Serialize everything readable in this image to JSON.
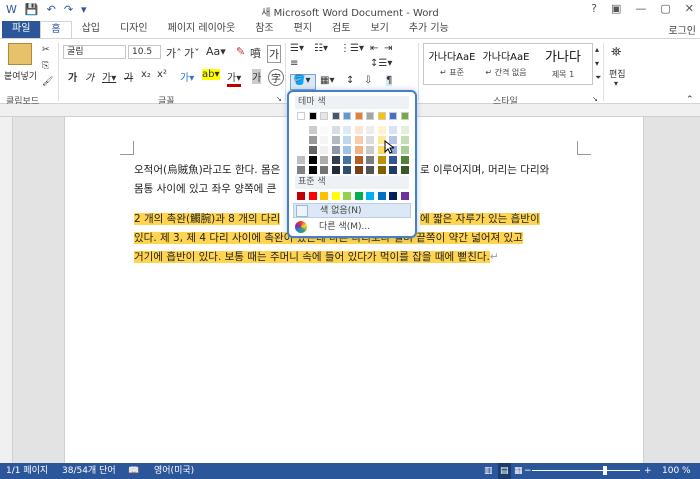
{
  "window": {
    "title": "새 Microsoft Word Document - Word"
  },
  "qat": {
    "save": "save",
    "undo": "undo",
    "redo": "redo"
  },
  "window_controls": {
    "help": "?",
    "ribbon_opts": "▣",
    "minimize": "—",
    "maximize": "▢",
    "close": "✕"
  },
  "tabs": [
    "파일",
    "홈",
    "삽입",
    "디자인",
    "페이지 레이아웃",
    "참조",
    "편지",
    "검토",
    "보기",
    "추가 기능"
  ],
  "account": "로그인",
  "ribbon": {
    "clipboard": {
      "paste_label": "붙여넣기",
      "group": "클립보드"
    },
    "font": {
      "name": "굴림",
      "size": "10.5",
      "group": "글꼴"
    },
    "styles": {
      "group": "스타일",
      "items": [
        {
          "preview": "가나다AaE",
          "name": "↵ 표준"
        },
        {
          "preview": "가나다AaE",
          "name": "↵ 간격 없음"
        },
        {
          "preview": "가나다",
          "name": "제목 1"
        }
      ]
    },
    "editing": {
      "label": "편집"
    }
  },
  "document": {
    "para1_line1": "오적어(烏賊魚)라고도 한다. 몸은",
    "para1_line1_tail": "로 이루어지며, 머리는 다리와",
    "para1_line2": "몸통 사이에 있고 좌우 양쪽에 큰",
    "hl_line1_a": "2 개의 촉완(觸腕)과 8 개의 다리",
    "hl_line1_b": "에 짧은 자루가 있는 흡반이",
    "hl_line2_a": "있다. 제 3, 제 4 다리 사이에 촉완이 있는데 다른 다리보다 길며 끝쪽이 약간 넓어져 있고",
    "hl_line3": "거기에 흡반이 있다. 보통 때는 주머니 속에 들어 있다가 먹이를 잡을 때에 뻗친다."
  },
  "color_dropdown": {
    "theme_header": "테마 색",
    "standard_header": "표준 색",
    "no_color": "색 없음(N)",
    "more_colors": "다른 색(M)...",
    "theme_colors": [
      "#ffffff",
      "#000000",
      "#e7e6e6",
      "#44546a",
      "#5b9bd5",
      "#ed7d31",
      "#a5a5a5",
      "#ffc000",
      "#4472c4",
      "#70ad47"
    ],
    "standard_colors": [
      "#c00000",
      "#ff0000",
      "#ffc000",
      "#ffff00",
      "#92d050",
      "#00b050",
      "#00b0f0",
      "#0070c0",
      "#002060",
      "#7030a0"
    ]
  },
  "status": {
    "page": "1/1 페이지",
    "words": "38/54개 단어",
    "language": "영어(미국)",
    "zoom": "100 %",
    "zoom_level": 100
  }
}
